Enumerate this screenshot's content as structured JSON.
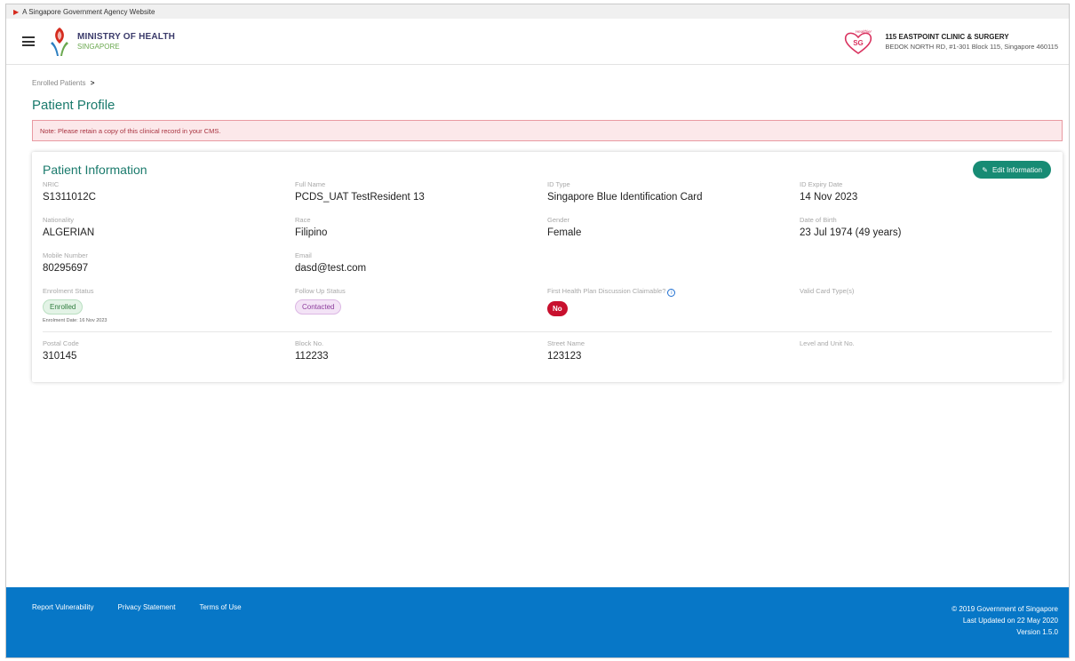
{
  "masthead": {
    "text": "A Singapore Government Agency Website"
  },
  "header": {
    "org_name": "MINISTRY OF HEALTH",
    "org_country": "SINGAPORE",
    "clinic_name": "115 EASTPOINT CLINIC & SURGERY",
    "clinic_address": "BEDOK NORTH RD, #1-301 Block 115, Singapore 460115",
    "hsg_logo_text_top": "Healthier",
    "hsg_logo_text": "SG"
  },
  "breadcrumb": {
    "item": "Enrolled Patients",
    "separator": ">"
  },
  "page_title": "Patient Profile",
  "note": "Note: Please retain a copy of this clinical record in your CMS.",
  "card": {
    "title": "Patient Information",
    "edit_label": "Edit Information",
    "fields": {
      "nric": {
        "label": "NRIC",
        "value": "S1311012C"
      },
      "full_name": {
        "label": "Full Name",
        "value": "PCDS_UAT TestResident 13"
      },
      "id_type": {
        "label": "ID Type",
        "value": "Singapore Blue Identification Card"
      },
      "id_expiry": {
        "label": "ID Expiry Date",
        "value": "14 Nov 2023"
      },
      "nationality": {
        "label": "Nationality",
        "value": "ALGERIAN"
      },
      "race": {
        "label": "Race",
        "value": "Filipino"
      },
      "gender": {
        "label": "Gender",
        "value": "Female"
      },
      "dob": {
        "label": "Date of Birth",
        "value": "23 Jul 1974 (49 years)"
      },
      "mobile": {
        "label": "Mobile Number",
        "value": "80295697"
      },
      "email": {
        "label": "Email",
        "value": "dasd@test.com"
      },
      "enrolment_status": {
        "label": "Enrolment Status",
        "value": "Enrolled",
        "date_note": "Enrolment Date: 16 Nov 2023"
      },
      "follow_up": {
        "label": "Follow Up Status",
        "value": "Contacted"
      },
      "fhpd": {
        "label": "First Health Plan Discussion Claimable?",
        "value": "No"
      },
      "card_types": {
        "label": "Valid Card Type(s)"
      },
      "postal": {
        "label": "Postal Code",
        "value": "310145"
      },
      "block": {
        "label": "Block No.",
        "value": "112233"
      },
      "street": {
        "label": "Street Name",
        "value": "123123"
      },
      "level_unit": {
        "label": "Level and Unit No."
      }
    }
  },
  "footer": {
    "links": [
      "Report Vulnerability",
      "Privacy Statement",
      "Terms of Use"
    ],
    "copyright": "© 2019 Government of Singapore",
    "updated": "Last Updated on 22 May 2020",
    "version": "Version 1.5.0"
  },
  "colors": {
    "primary": "#1a7a6c",
    "button": "#178b74",
    "footer": "#0777c7",
    "alert": "#c8102e"
  }
}
